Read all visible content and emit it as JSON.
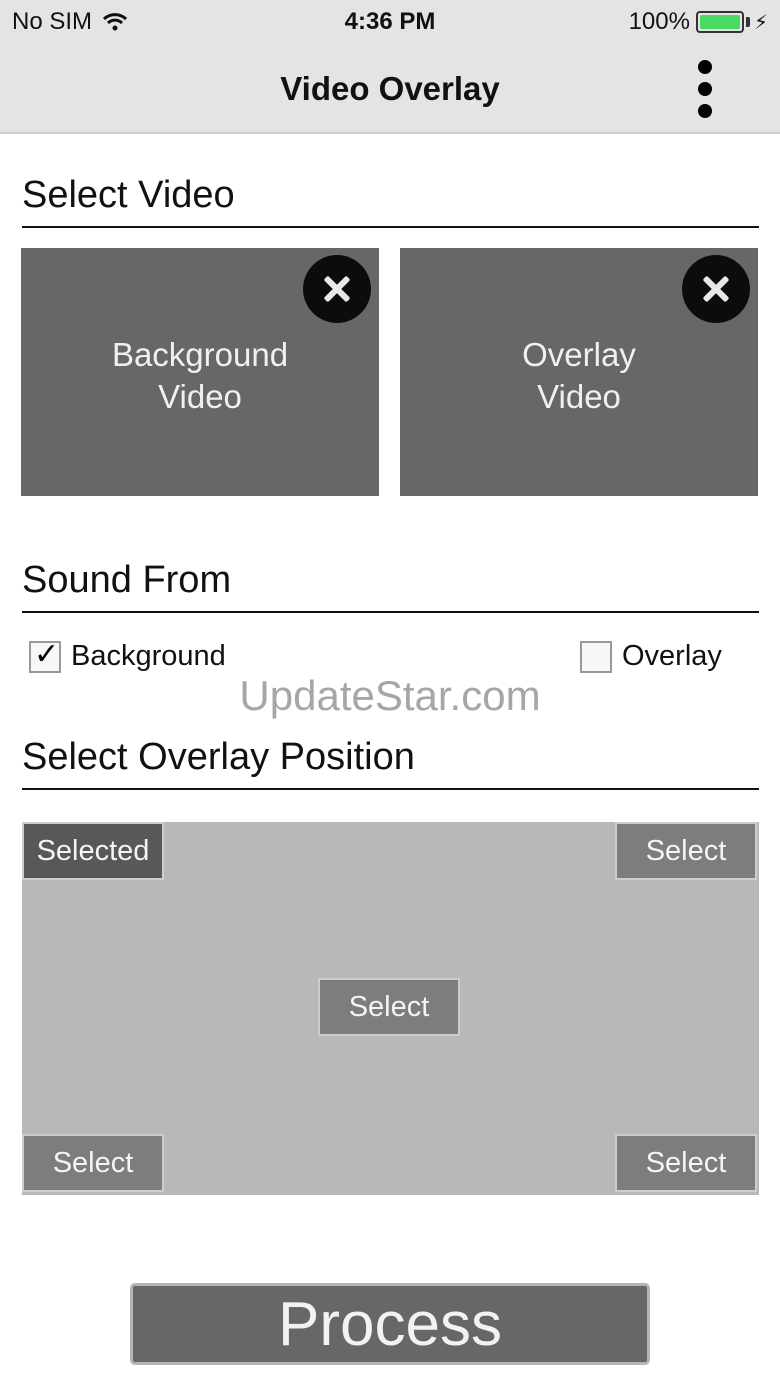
{
  "status_bar": {
    "carrier": "No SIM",
    "time": "4:36 PM",
    "battery_percent": "100%",
    "battery_level": 1.0
  },
  "nav": {
    "title": "Video Overlay",
    "menu_icon": "more-vertical-icon"
  },
  "select_video": {
    "title": "Select Video",
    "background": {
      "line1": "Background",
      "line2": "Video"
    },
    "overlay": {
      "line1": "Overlay",
      "line2": "Video"
    },
    "close_icon": "close-icon"
  },
  "sound_from": {
    "title": "Sound From",
    "options": [
      {
        "label": "Background",
        "checked": true
      },
      {
        "label": "Overlay",
        "checked": false
      }
    ]
  },
  "watermark": "UpdateStar.com",
  "overlay_position": {
    "title": "Select Overlay Position",
    "buttons": {
      "top_left": "Selected",
      "top_right": "Select",
      "center": "Select",
      "bottom_left": "Select",
      "bottom_right": "Select"
    },
    "selected_position": "top_left"
  },
  "process_label": "Process",
  "colors": {
    "bar_bg": "#e4e4e4",
    "tile_bg": "#676767",
    "position_area_bg": "#b8b8b8",
    "battery_green": "#4cd964"
  }
}
